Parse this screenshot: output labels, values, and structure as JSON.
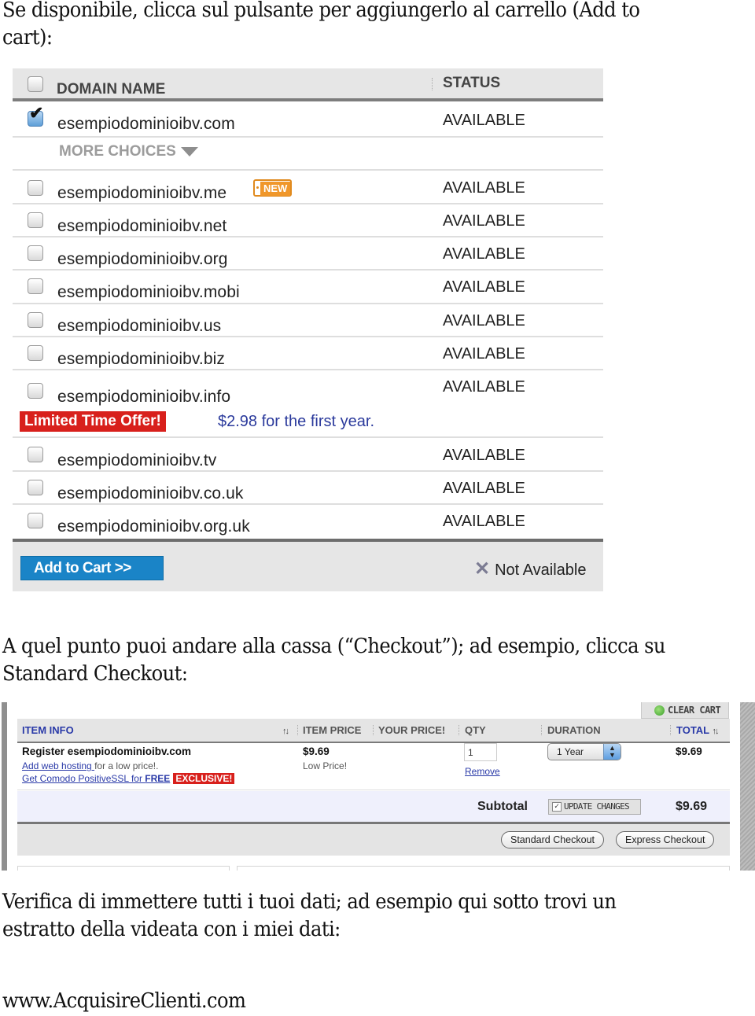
{
  "paragraphs": {
    "intro_line1": "Se disponibile, clicca sul pulsante per aggiungerlo al carrello (Add to",
    "intro_line2": "cart):",
    "checkout_line1": "A quel punto puoi andare alla cassa (“Checkout”); ad esempio, clicca su",
    "checkout_line2": "Standard Checkout:",
    "verify_line1": "Verifica di immettere tutti i tuoi dati; ad esempio qui sotto trovi un",
    "verify_line2": "estratto della videata con i miei dati:",
    "footer_url": "www.AcquisireClienti.com"
  },
  "domain_search": {
    "header": {
      "domain_col": "DOMAIN NAME",
      "status_col": "STATUS",
      "select_all_checked": false
    },
    "primary": {
      "name": "esempiodominioibv.com",
      "status": "AVAILABLE",
      "checked": true
    },
    "more_choices_label": "MORE CHOICES",
    "choices": [
      {
        "name": "esempiodominioibv.me",
        "status": "AVAILABLE",
        "checked": false,
        "badge": "NEW"
      },
      {
        "name": "esempiodominioibv.net",
        "status": "AVAILABLE",
        "checked": false
      },
      {
        "name": "esempiodominioibv.org",
        "status": "AVAILABLE",
        "checked": false
      },
      {
        "name": "esempiodominioibv.mobi",
        "status": "AVAILABLE",
        "checked": false
      },
      {
        "name": "esempiodominioibv.us",
        "status": "AVAILABLE",
        "checked": false
      },
      {
        "name": "esempiodominioibv.biz",
        "status": "AVAILABLE",
        "checked": false
      },
      {
        "name": "esempiodominioibv.info",
        "status": "AVAILABLE",
        "checked": false,
        "offer_badge": "Limited Time Offer!",
        "offer_text": "$2.98 for the first year."
      },
      {
        "name": "esempiodominioibv.tv",
        "status": "AVAILABLE",
        "checked": false
      },
      {
        "name": "esempiodominioibv.co.uk",
        "status": "AVAILABLE",
        "checked": false
      },
      {
        "name": "esempiodominioibv.org.uk",
        "status": "AVAILABLE",
        "checked": false
      }
    ],
    "footer": {
      "add_to_cart_label": "Add to Cart >>",
      "legend_icon": "x-icon",
      "legend_label": "Not Available"
    }
  },
  "cart": {
    "clear_cart_label": "CLEAR CART",
    "columns": {
      "item_info": "ITEM INFO",
      "item_price": "ITEM PRICE",
      "your_price": "YOUR PRICE!",
      "qty": "QTY",
      "duration": "DURATION",
      "total": "TOTAL",
      "sort_glyph": "↑↓"
    },
    "item": {
      "title": "Register esempiodominioibv.com",
      "hosting_link": "Add web hosting ",
      "hosting_suffix": "for a low price!.",
      "ssl_link_prefix": "Get Comodo PositiveSSL for ",
      "ssl_link_bold": "FREE",
      "exclusive_badge": "EXCLUSIVE!",
      "price": "$9.69",
      "price_note": "Low Price!",
      "qty": "1",
      "remove_label": "Remove",
      "duration": "1 Year",
      "total": "$9.69"
    },
    "subtotal_label": "Subtotal",
    "update_changes_label": "UPDATE CHANGES",
    "update_checked": true,
    "subtotal_value": "$9.69",
    "standard_checkout_label": "Standard Checkout",
    "express_checkout_label": "Express Checkout"
  }
}
